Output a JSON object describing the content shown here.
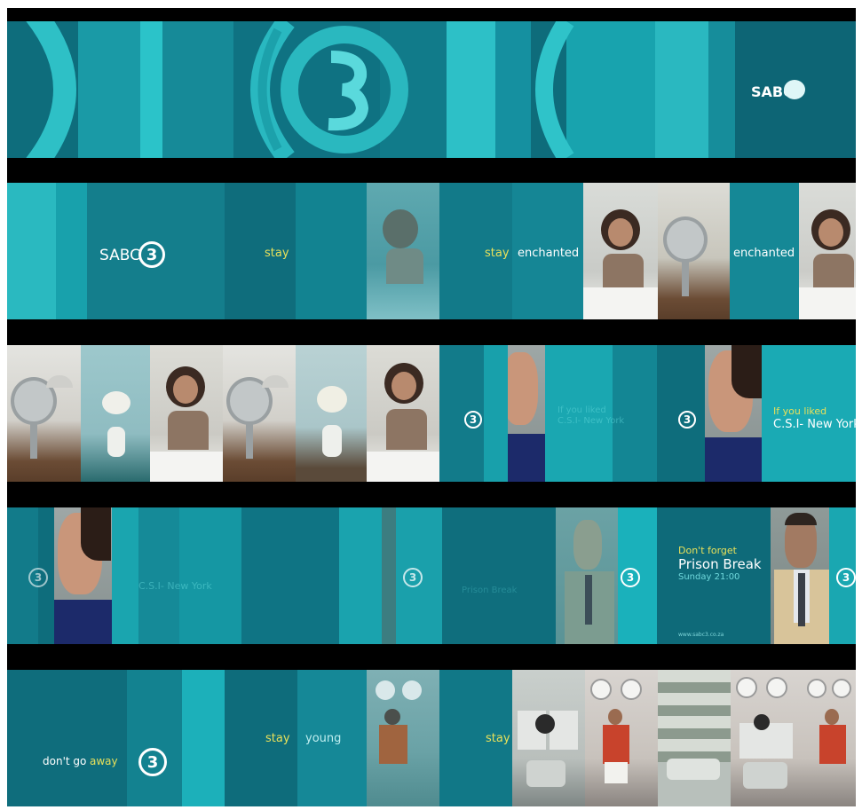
{
  "colors": {
    "teal_dark": "#0b5e6d",
    "teal_mid": "#0e7586",
    "teal_light": "#20b5be",
    "teal_bright": "#37ccd2",
    "yellow": "#e8e05a"
  },
  "strip1": {
    "logo_text": "SABC",
    "logo_icon": "sabc-3-logo-icon"
  },
  "strip2": {
    "logo_text": "SABC",
    "logo_number": "3",
    "word_stay_1": "stay",
    "word_stay_2": "stay",
    "word_enchanted_1": "enchanted",
    "word_enchanted_2": "enchanted"
  },
  "strip3": {
    "logo_number_1": "3",
    "faded_line_1": "If you liked",
    "faded_line_2": "C.S.I- New York",
    "logo_number_2": "3",
    "if_you_liked": "If you liked",
    "show_name": "C.S.I- New York"
  },
  "strip4": {
    "logo_number_1": "3",
    "faded_show": "C.S.I- New York",
    "logo_number_2": "3",
    "faded_prison": "Prison Break",
    "logo_number_3": "3",
    "dont_forget": "Don't forget",
    "prison_break": "Prison Break",
    "time": "Sunday 21:00",
    "website": "www.sabc3.co.za",
    "logo_number_4": "3"
  },
  "strip5": {
    "dont_go": "don't go",
    "away": "away",
    "logo_number": "3",
    "stay_1": "stay",
    "young": "young",
    "stay_2": "stay"
  }
}
